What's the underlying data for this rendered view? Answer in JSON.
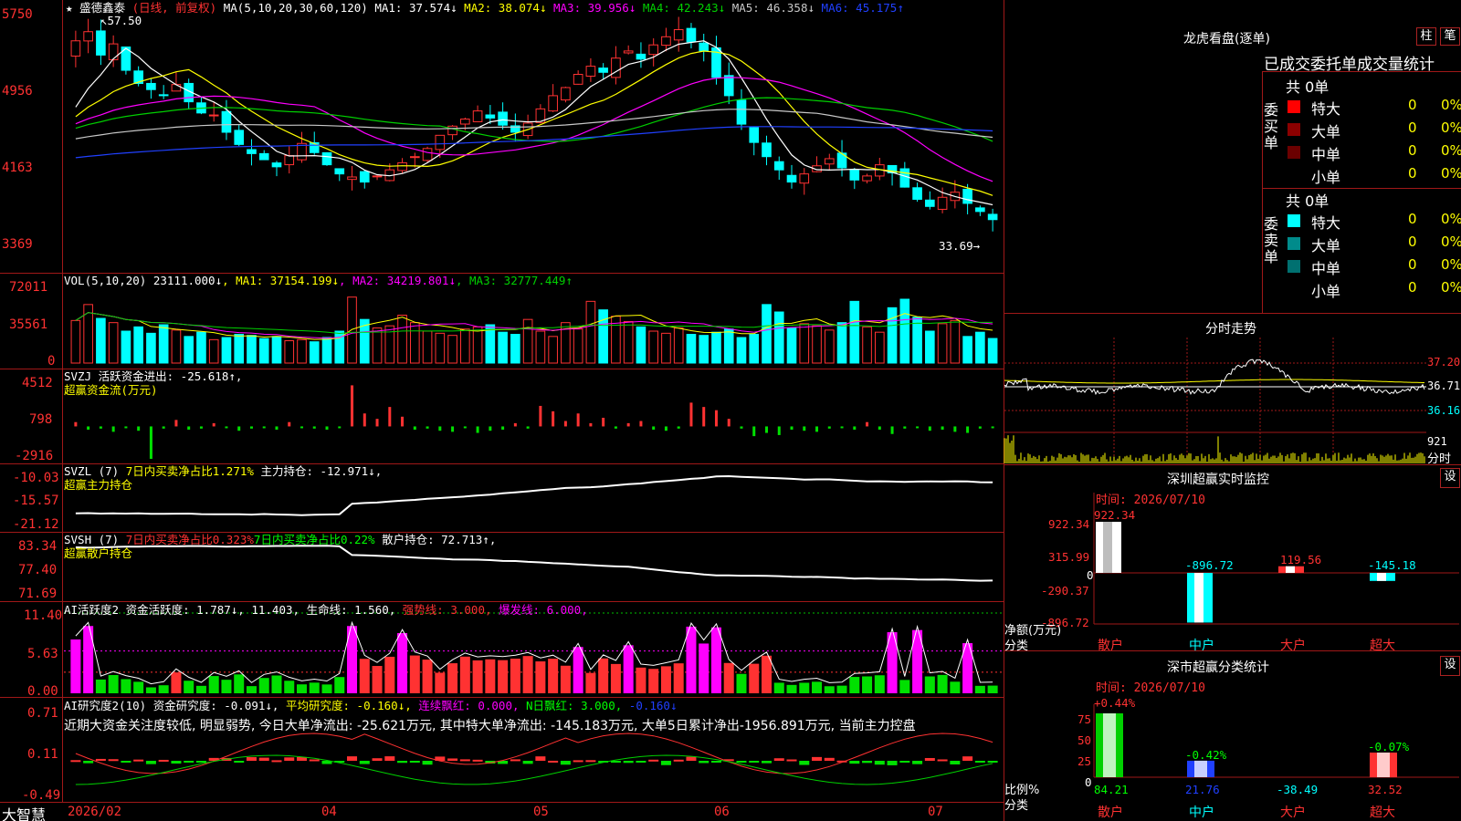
{
  "colors": {
    "up": "#ff3232",
    "down": "#00ffff",
    "frame": "#a01818",
    "yellow": "#ffff00",
    "magenta": "#ff00ff",
    "green": "#00d000"
  },
  "app_name": "大智慧",
  "stock": {
    "name": "盛德鑫泰",
    "period": "(日线, 前复权)",
    "ma_header": "MA(5,10,20,30,60,120)",
    "ma": [
      {
        "label": "MA1: 37.574↓",
        "color": "#ffffff"
      },
      {
        "label": "MA2: 38.074↓",
        "color": "#ffff00"
      },
      {
        "label": "MA3: 39.956↓",
        "color": "#ff00ff"
      },
      {
        "label": "MA4: 42.243↓",
        "color": "#00d000"
      },
      {
        "label": "MA5: 46.358↓",
        "color": "#c8c8c8"
      },
      {
        "label": "MA6: 45.175↑",
        "color": "#2040ff"
      }
    ],
    "high_label": "57.50",
    "low_label": "33.69"
  },
  "chart_data": [
    {
      "type": "candlestick",
      "title": "盛德鑫泰 (日线, 前复权)",
      "ylim": [
        33.0,
        58.5
      ],
      "y_ticks": [
        "5750",
        "4956",
        "4163",
        "3369"
      ],
      "x_ticks": [
        "2026/02",
        "04",
        "05",
        "06",
        "07"
      ],
      "close": [
        55.2,
        56.1,
        53.8,
        54.9,
        52.3,
        51.0,
        50.4,
        49.8,
        50.9,
        49.2,
        48.1,
        47.9,
        46.2,
        45.0,
        44.1,
        43.5,
        42.8,
        43.9,
        45.1,
        44.2,
        43.0,
        42.1,
        41.8,
        41.3,
        41.9,
        42.5,
        43.2,
        43.8,
        44.6,
        45.9,
        46.8,
        47.5,
        48.3,
        47.6,
        46.9,
        46.2,
        47.1,
        48.5,
        49.8,
        50.6,
        51.9,
        52.7,
        52.1,
        53.5,
        54.2,
        53.4,
        54.8,
        55.6,
        56.3,
        55.1,
        54.2,
        51.6,
        49.8,
        47.0,
        45.2,
        43.8,
        42.5,
        41.3,
        42.1,
        42.9,
        43.6,
        42.7,
        41.5,
        41.9,
        43.0,
        42.2,
        40.8,
        39.6,
        38.9,
        39.8,
        40.3,
        39.2,
        38.4,
        37.6
      ],
      "series": [
        {
          "name": "MA1"
        },
        {
          "name": "MA2"
        },
        {
          "name": "MA3"
        },
        {
          "name": "MA4"
        },
        {
          "name": "MA5"
        },
        {
          "name": "MA6"
        }
      ]
    },
    {
      "type": "bar",
      "title": "VOL(5,10,20)",
      "ylim": [
        0,
        72011
      ],
      "y_ticks": [
        "72011",
        "35561",
        "0"
      ],
      "values": [
        40000,
        55000,
        42000,
        38000,
        30000,
        34000,
        28000,
        36000,
        31000,
        25000,
        29000,
        22000,
        24000,
        27000,
        26000,
        23000,
        25000,
        21000,
        22000,
        20000,
        24000,
        30000,
        62000,
        41000,
        33000,
        35000,
        45000,
        38000,
        30000,
        28000,
        26000,
        32000,
        34000,
        36000,
        29000,
        27000,
        41000,
        30000,
        25000,
        38000,
        32000,
        58000,
        50000,
        44000,
        39000,
        34000,
        30000,
        28000,
        33000,
        27000,
        26000,
        29000,
        32000,
        24000,
        27000,
        55000,
        48000,
        33000,
        37000,
        35000,
        31000,
        38000,
        58000,
        34000,
        29000,
        52000,
        60000,
        43000,
        30000,
        37000,
        40000,
        25000,
        29000,
        23111
      ],
      "series": [
        {
          "name": "MA1: 37154.199↓",
          "color": "#ffff00"
        },
        {
          "name": "MA2: 34219.801↓",
          "color": "#ff00ff"
        },
        {
          "name": "MA3: 32777.449↑",
          "color": "#00d000"
        }
      ]
    },
    {
      "type": "bar",
      "title": "SVZJ 活跃资金进出: -25.618↑",
      "subtitle": "超赢资金流(万元)",
      "ylim": [
        -2916,
        4512
      ],
      "y_ticks": [
        "4512",
        "798",
        "-2916"
      ],
      "values": [
        400,
        -300,
        -200,
        -500,
        -100,
        -400,
        -3000,
        -200,
        600,
        -300,
        -200,
        300,
        -100,
        -400,
        -200,
        -100,
        -300,
        400,
        -100,
        -200,
        -300,
        -150,
        3800,
        1200,
        700,
        1800,
        900,
        -300,
        -200,
        -400,
        -500,
        -100,
        -600,
        -400,
        -300,
        300,
        -200,
        1900,
        1400,
        500,
        1200,
        300,
        800,
        -200,
        300,
        500,
        -300,
        -400,
        -200,
        2200,
        1800,
        1500,
        700,
        -200,
        -900,
        -600,
        -800,
        -300,
        -400,
        -500,
        -200,
        -100,
        -300,
        400,
        -300,
        -700,
        -200,
        -100,
        -400,
        -300,
        -500,
        -600,
        -200,
        -25.618
      ]
    },
    {
      "type": "line",
      "title": "SVZL (7) 7日内买卖净占比1.271% 主力持仓: -12.971↓",
      "subtitle": "超赢主力持仓",
      "ylim": [
        -21.12,
        -10.03
      ],
      "y_ticks": [
        "-10.03",
        "-15.57",
        "-21.12"
      ]
    },
    {
      "type": "line",
      "title": "SVSH (7) 7日内买卖净占比0.323% 7日内买卖净占比0.22% 散户持仓: 72.713↑",
      "subtitle": "超赢散户持仓",
      "ylim": [
        71.69,
        83.34
      ],
      "y_ticks": [
        "83.34",
        "77.40",
        "71.69"
      ]
    },
    {
      "type": "bar",
      "title": "AI活跃度2 资金活跃度: 1.787↓ 11.403 生命线: 1.560 强势线: 3.000 爆发线: 6.000",
      "ylim": [
        0,
        11.4
      ],
      "y_ticks": [
        "11.40",
        "5.63",
        "0.00"
      ]
    },
    {
      "type": "bar",
      "title": "AI研究度2(10) 资金研究度: -0.091↓ 平均研究度: -0.160↓ 连续飘红: 0.000 N日飘红: 3.000 -0.160↓",
      "ylim": [
        -0.49,
        0.71
      ],
      "y_ticks": [
        "0.71",
        "0.11",
        "-0.49"
      ]
    },
    {
      "type": "bar",
      "title": "深圳超赢实时监控",
      "subtitle": "时间: 2026/07/10",
      "ylabel": "净额(万元)",
      "xlabel": "分类",
      "categories": [
        "散户",
        "中户",
        "大户",
        "超大"
      ],
      "values": [
        922.34,
        -896.72,
        119.56,
        -145.18
      ],
      "y_ticks": [
        "922.34",
        "315.99",
        "0",
        "-290.37",
        "-896.72"
      ]
    },
    {
      "type": "bar",
      "title": "深市超赢分类统计",
      "subtitle": "时间: 2026/07/10",
      "ylabel": "比例%",
      "xlabel": "分类",
      "categories": [
        "散户",
        "中户",
        "大户",
        "超大"
      ],
      "values": [
        84.21,
        21.76,
        -38.49,
        32.52
      ],
      "changes": [
        "+0.44%",
        "-0.42%",
        "",
        "-0.07%"
      ],
      "y_ticks": [
        "75",
        "50",
        "25",
        "0"
      ]
    },
    {
      "type": "line",
      "title": "分时走势",
      "y_ticks": [
        "37.20",
        "36.71",
        "36.16",
        "921",
        "分时"
      ]
    }
  ],
  "panels": {
    "vol_header": "VOL(5,10,20)",
    "vol_value": "23111.000↓",
    "svzj_l1": "SVZJ  活跃资金进出: -25.618↑,",
    "svzj_l2": "超赢资金流(万元)",
    "svzl_l1a": "SVZL (7) ",
    "svzl_l1b": "7日内买卖净占比1.271%",
    "svzl_l1c": " 主力持仓: -12.971↓,",
    "svzl_l2": "超赢主力持仓",
    "svsh_l1a": "SVSH (7) ",
    "svsh_l1b": "7日内买卖净占比0.323%",
    "svsh_l1c": "7日内买卖净占比0.22%",
    "svsh_l1d": " 散户持仓: 72.713↑,",
    "svsh_l2": "超赢散户持仓",
    "ai1_a": "AI活跃度2 资金活跃度: 1.787↓, 11.403, 生命线: 1.560, ",
    "ai1_b": "强势线: 3.000, ",
    "ai1_c": "爆发线: 6.000,",
    "ai2_a": "AI研究度2(10) 资金研究度: -0.091↓, ",
    "ai2_b": "平均研究度: -0.160↓, ",
    "ai2_c": "连续飘红: 0.000, ",
    "ai2_d": "N日飘红: 3.000, ",
    "ai2_e": "-0.160↓",
    "ai2_text": "近期大资金关注度较低, 明显弱势, 今日大单净流出: -25.621万元, 其中特大单净流出: -145.183万元, 大单5日累计净出-1956.891万元, 当前主力控盘"
  },
  "right": {
    "lhb_title": "龙虎看盘(逐单)",
    "btn_zhu": "柱",
    "btn_bi": "笔",
    "stat_title": "已成交委托单成交量统计",
    "buy_total": "共 0单",
    "sell_total": "共 0单",
    "buy_label": "委买单",
    "sell_label": "委卖单",
    "buy_rows": [
      {
        "label": "特大",
        "v": "0",
        "p": "0%"
      },
      {
        "label": "大单",
        "v": "0",
        "p": "0%"
      },
      {
        "label": "中单",
        "v": "0",
        "p": "0%"
      },
      {
        "label": "小单",
        "v": "0",
        "p": "0%"
      }
    ],
    "sell_rows": [
      {
        "label": "特大",
        "v": "0",
        "p": "0%"
      },
      {
        "label": "大单",
        "v": "0",
        "p": "0%"
      },
      {
        "label": "中单",
        "v": "0",
        "p": "0%"
      },
      {
        "label": "小单",
        "v": "0",
        "p": "0%"
      }
    ],
    "ts_title": "分时走势",
    "ts_ticks": [
      "37.20",
      "36.71",
      "36.16",
      "921",
      "分时"
    ],
    "sz_title": "深圳超赢实时监控",
    "sz_time": "时间: 2026/07/10",
    "sz_ylabel": "净额(万元)",
    "sz_xlabel": "分类",
    "sz_ticks": [
      "922.34",
      "315.99",
      "0",
      "-290.37",
      "-896.72"
    ],
    "sz_values": [
      "922.34",
      "-896.72",
      "119.56",
      "-145.18"
    ],
    "cls_title": "深市超赢分类统计",
    "cls_time": "时间: 2026/07/10",
    "cls_ylabel": "比例%",
    "cls_xlabel": "分类",
    "cls_ticks": [
      "75",
      "50",
      "25",
      "0"
    ],
    "cls_changes": [
      "+0.44%",
      "-0.42%",
      "-0.07%"
    ],
    "cls_values": [
      "84.21",
      "21.76",
      "-38.49",
      "32.52"
    ],
    "categories": [
      "散户",
      "中户",
      "大户",
      "超大"
    ],
    "settings": "设"
  }
}
